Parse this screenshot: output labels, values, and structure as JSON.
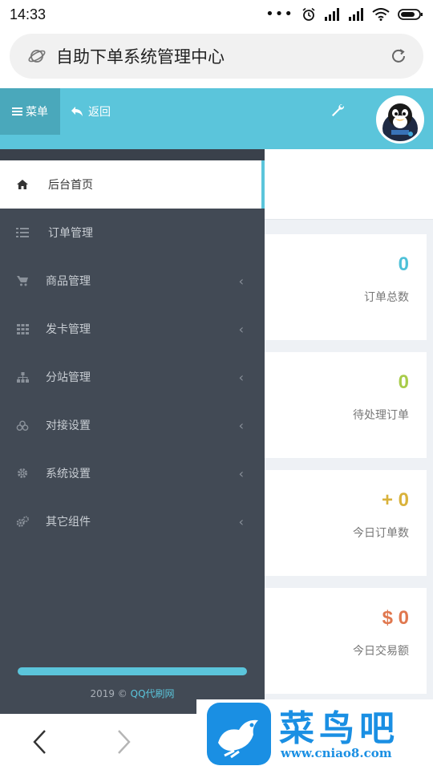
{
  "status_bar": {
    "time": "14:33",
    "dots": "•••"
  },
  "browser": {
    "url": "自助下单系统管理中心"
  },
  "header": {
    "menu_label": "菜单",
    "back_label": "返回"
  },
  "sidebar": {
    "items": [
      {
        "label": "后台首页",
        "icon": "home-icon",
        "active": true
      },
      {
        "label": "订单管理",
        "icon": "list-icon",
        "has_chevron": false
      },
      {
        "label": "商品管理",
        "icon": "cart-icon",
        "has_chevron": true
      },
      {
        "label": "发卡管理",
        "icon": "grid-icon",
        "has_chevron": true
      },
      {
        "label": "分站管理",
        "icon": "sitemap-icon",
        "has_chevron": true
      },
      {
        "label": "对接设置",
        "icon": "cubes-icon",
        "has_chevron": true
      },
      {
        "label": "系统设置",
        "icon": "gear-icon",
        "has_chevron": true
      },
      {
        "label": "其它组件",
        "icon": "gears-icon",
        "has_chevron": true
      }
    ],
    "chevron": "‹",
    "footer_year": "2019 ©",
    "footer_link": "QQ代刷网"
  },
  "stats": [
    {
      "value": "0",
      "label": "订单总数",
      "color": "#4fc1d8"
    },
    {
      "value": "0",
      "label": "待处理订单",
      "color": "#a8cc4a"
    },
    {
      "value": "+ 0",
      "label": "今日订单数",
      "color": "#d9b23b"
    },
    {
      "value": "$ 0",
      "label": "今日交易额",
      "color": "#e0784f"
    }
  ],
  "watermark": {
    "title": "菜鸟吧",
    "url": "www.cniao8.com"
  },
  "colors": {
    "accent": "#5bc5db",
    "sidebar_bg": "#424a55"
  }
}
